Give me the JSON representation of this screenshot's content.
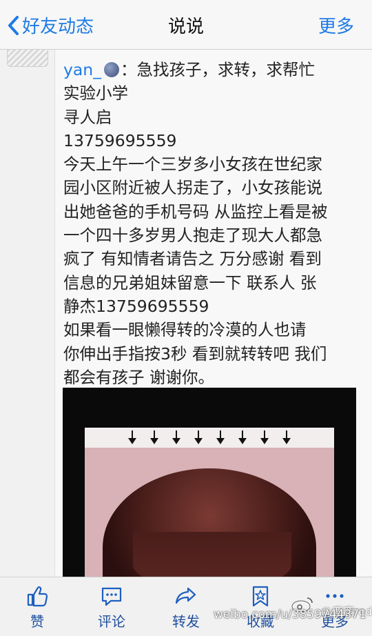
{
  "nav": {
    "back_label": "好友动态",
    "title": "说说",
    "more_label": "更多"
  },
  "post": {
    "author": "yan_",
    "title_text": "：急找孩子，求转，求帮忙",
    "lines": [
      "实验小学",
      "寻人启",
      "13759695559",
      "今天上午一个三岁多小女孩在世纪家",
      "园小区附近被人拐走了，小女孩能说",
      "出她爸爸的手机号码 从监控上看是被",
      "一个四十多岁男人抱走了现大人都急",
      "疯了 有知情者请告之 万分感谢 看到",
      "信息的兄弟姐妹留意一下 联系人 张",
      "静杰13759695559",
      "如果看一眼懒得转的冷漠的人也请",
      "你伸出手指按3秒 看到就转转吧 我们",
      "都会有孩子 谢谢你。"
    ]
  },
  "toolbar": {
    "like_label": "赞",
    "comment_label": "评论",
    "share_label": "转发",
    "favorite_label": "收藏",
    "more_label": "更多"
  },
  "watermark": {
    "name": "@鹿鹿red",
    "url": "weibo.com/u/3859744371"
  },
  "colors": {
    "accent": "#1e7be6",
    "toolbar_text": "#1f4f9e"
  }
}
